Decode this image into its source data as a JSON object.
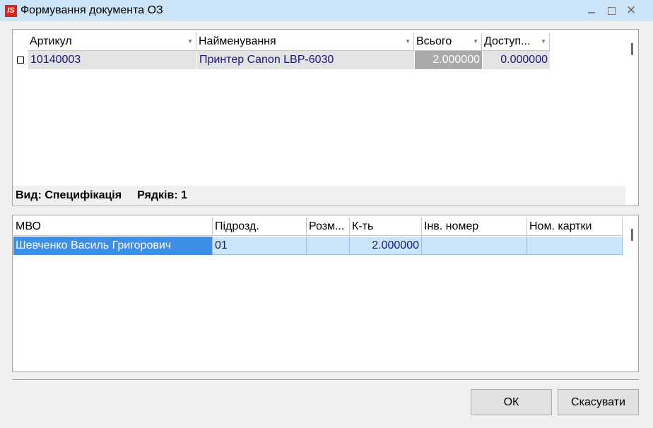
{
  "window": {
    "icon_text": "IS",
    "title": "Формування документа ОЗ",
    "minimize_icon": "minimize-icon",
    "maximize_icon": "maximize-icon",
    "close_icon": "close-icon"
  },
  "top_grid": {
    "columns": [
      "Артикул",
      "Найменування",
      "Всього",
      "Доступ..."
    ],
    "rows": [
      {
        "article": "10140003",
        "name": "Принтер Canon LBP-6030",
        "total": "2.000000",
        "available": "0.000000"
      }
    ],
    "status": {
      "view": "Вид: Специфікація",
      "rows_count": "Рядків: 1"
    }
  },
  "bottom_grid": {
    "columns": [
      "МВО",
      "Підрозд.",
      "Розм...",
      "К-ть",
      "Інв. номер",
      "Ном. картки"
    ],
    "rows": [
      {
        "mvo": "Шевченко Василь Григорович",
        "subdivision": "01",
        "size": "",
        "quantity": "2.000000",
        "inv_number": "",
        "card_number": ""
      }
    ]
  },
  "buttons": {
    "ok": "ОК",
    "cancel": "Скасувати"
  },
  "colors": {
    "titlebar": "#cce4f7",
    "selected_row": "#cce4fa",
    "selected_cell": "#3c8ee6",
    "row_text": "#17177c",
    "app_icon": "#d9251d"
  }
}
